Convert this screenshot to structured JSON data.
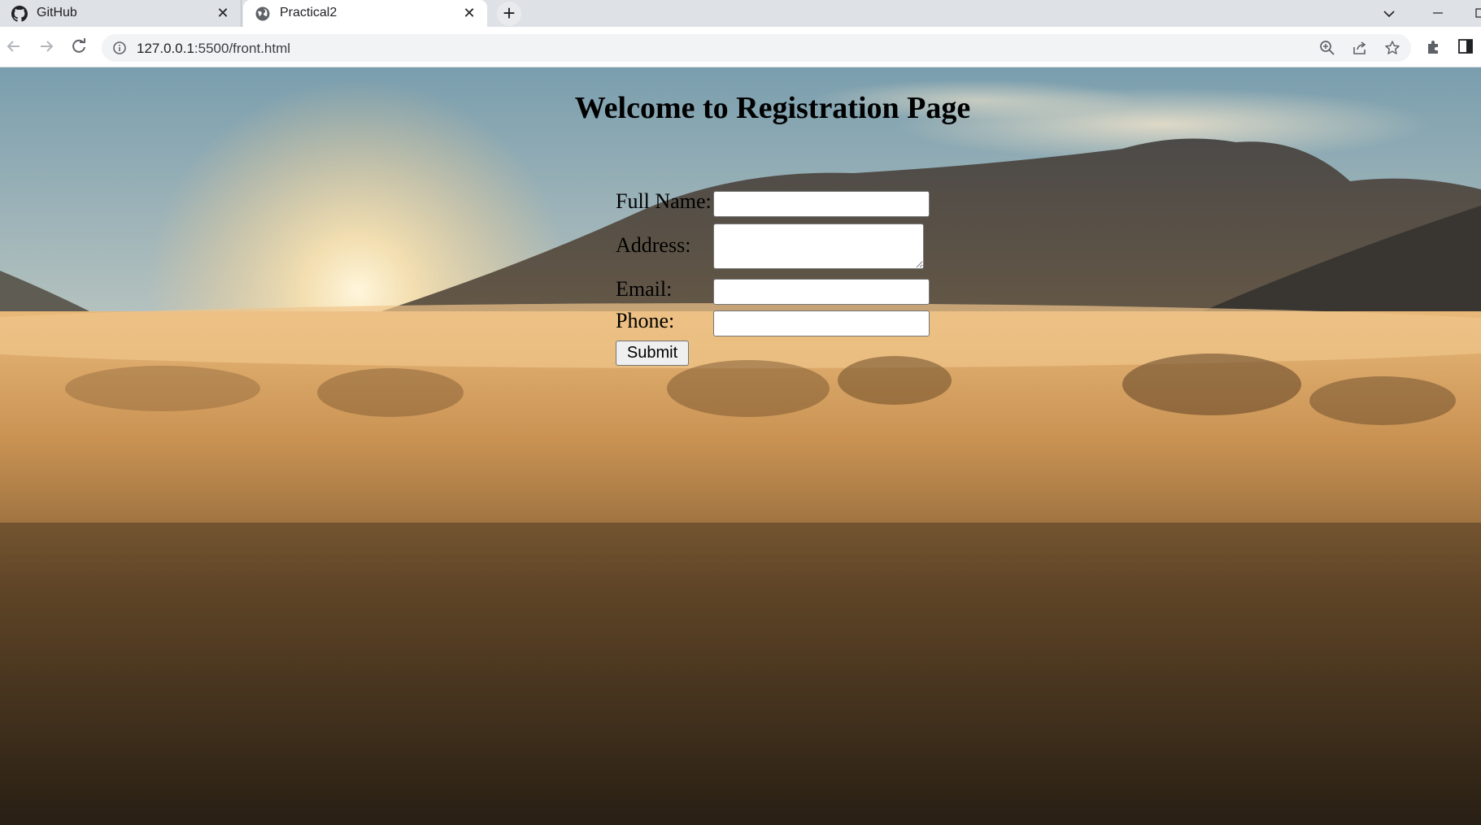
{
  "browser": {
    "tabs": [
      {
        "title": "GitHub",
        "icon": "github-icon",
        "active": false
      },
      {
        "title": "Practical2",
        "icon": "globe-icon",
        "active": true
      }
    ],
    "url_host": "127.0.0.1",
    "url_rest": ":5500/front.html"
  },
  "page": {
    "title": "Welcome to Registration Page",
    "form": {
      "full_name_label": "Full Name:",
      "address_label": "Address:",
      "email_label": "Email:",
      "phone_label": "Phone:",
      "full_name_value": "",
      "address_value": "",
      "email_value": "",
      "phone_value": "",
      "submit_label": "Submit"
    }
  },
  "colors": {
    "tab_strip": "#dee1e6",
    "omnibox": "#f1f3f4",
    "sky": "#8fb0bd",
    "sunlight": "#f5d9a3",
    "mountain": "#4a4640",
    "fog": "#c89a5c",
    "ground": "#2e2417"
  }
}
